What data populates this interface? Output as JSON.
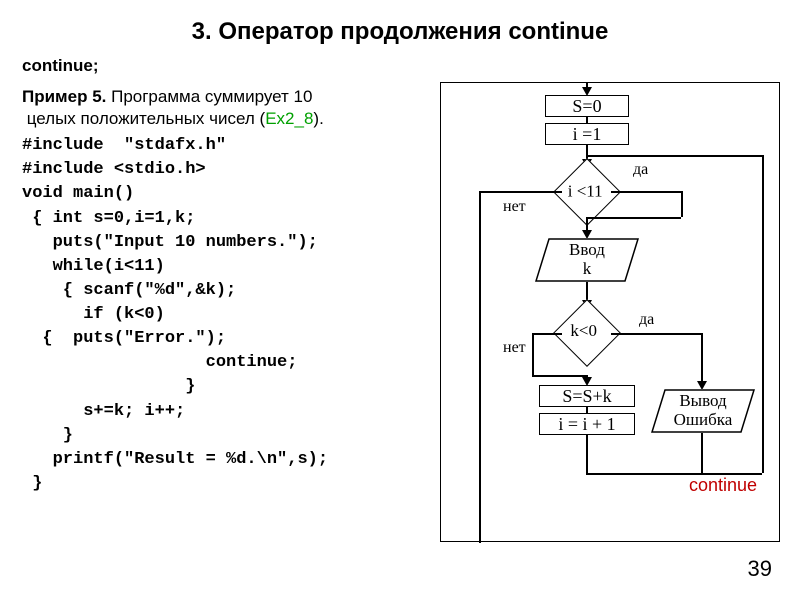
{
  "title": "3. Оператор продолжения continue",
  "subtitle": "continue;",
  "example_bold": "Пример 5.",
  "example_rest1": " Программа суммирует 10",
  "example_rest2": "целых положительных чисел (",
  "example_ex": "Ex2_8",
  "example_rest3": ").",
  "code": "#include  \"stdafx.h\"\n#include <stdio.h>\nvoid main()\n { int s=0,i=1,k;\n   puts(\"Input 10 numbers.\");\n   while(i<11)\n    { scanf(\"%d\",&k);\n      if (k<0)\n  {  puts(\"Error.\");\n                  continue;\n                }\n      s+=k; i++;\n    }\n   printf(\"Result = %d.\\n\",s);\n }",
  "page_number": "39",
  "flow": {
    "s0": "S=0",
    "i1": "i =1",
    "cond1": "i <11",
    "input": "Ввод\nk",
    "cond2": "k<0",
    "ssk": "S=S+k",
    "ii1": "i = i + 1",
    "error_out": "Вывод\nОшибка",
    "yes": "да",
    "no": "нет",
    "continue": "continue"
  },
  "chart_data": {
    "type": "table",
    "description": "Flowchart for C continue-statement example (summing 10 positive integers)",
    "nodes": [
      {
        "id": "n1",
        "shape": "rect",
        "label": "S=0"
      },
      {
        "id": "n2",
        "shape": "rect",
        "label": "i = 1"
      },
      {
        "id": "n3",
        "shape": "diamond",
        "label": "i < 11"
      },
      {
        "id": "n4",
        "shape": "parallelogram",
        "label": "Ввод k"
      },
      {
        "id": "n5",
        "shape": "diamond",
        "label": "k < 0"
      },
      {
        "id": "n6",
        "shape": "rect",
        "label": "S = S + k"
      },
      {
        "id": "n7",
        "shape": "rect",
        "label": "i = i + 1"
      },
      {
        "id": "n8",
        "shape": "parallelogram",
        "label": "Вывод Ошибка"
      }
    ],
    "edges": [
      {
        "from": "start",
        "to": "n1"
      },
      {
        "from": "n1",
        "to": "n2"
      },
      {
        "from": "n2",
        "to": "n3"
      },
      {
        "from": "n3",
        "to": "n4",
        "label": "да"
      },
      {
        "from": "n3",
        "to": "exit",
        "label": "нет"
      },
      {
        "from": "n4",
        "to": "n5"
      },
      {
        "from": "n5",
        "to": "n6",
        "label": "нет"
      },
      {
        "from": "n5",
        "to": "n8",
        "label": "да"
      },
      {
        "from": "n6",
        "to": "n7"
      },
      {
        "from": "n7",
        "to": "n3",
        "note": "loop back"
      },
      {
        "from": "n8",
        "to": "n3",
        "note": "continue → loop back"
      }
    ]
  }
}
